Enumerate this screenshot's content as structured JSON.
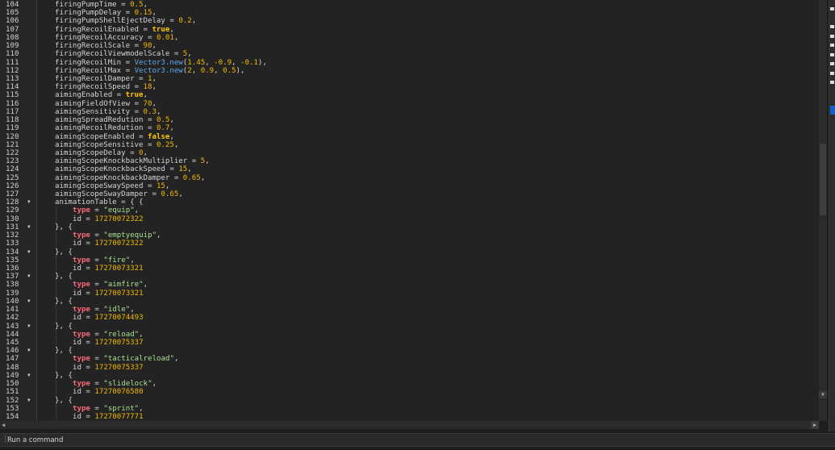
{
  "editor": {
    "lines": [
      {
        "n": "104",
        "i": 0,
        "t": [
          [
            "",
            "firingPumpTime = "
          ],
          [
            "num",
            "0.5"
          ],
          [
            "",
            ","
          ]
        ]
      },
      {
        "n": "105",
        "i": 0,
        "t": [
          [
            "",
            "firingPumpDelay = "
          ],
          [
            "num",
            "0.15"
          ],
          [
            "",
            ","
          ]
        ]
      },
      {
        "n": "106",
        "i": 0,
        "t": [
          [
            "",
            "firingPumpShellEjectDelay = "
          ],
          [
            "num",
            "0.2"
          ],
          [
            "",
            ","
          ]
        ]
      },
      {
        "n": "107",
        "i": 0,
        "t": [
          [
            "",
            "firingRecoilEnabled = "
          ],
          [
            "bool",
            "true"
          ],
          [
            "",
            ","
          ]
        ]
      },
      {
        "n": "108",
        "i": 0,
        "t": [
          [
            "",
            "firingRecoilAccuracy = "
          ],
          [
            "num",
            "0.01"
          ],
          [
            "",
            ","
          ]
        ]
      },
      {
        "n": "109",
        "i": 0,
        "t": [
          [
            "",
            "firingRecoilScale = "
          ],
          [
            "num",
            "90"
          ],
          [
            "",
            ","
          ]
        ]
      },
      {
        "n": "110",
        "i": 0,
        "t": [
          [
            "",
            "firingRecoilViewmodelScale = "
          ],
          [
            "num",
            "5"
          ],
          [
            "",
            ","
          ]
        ]
      },
      {
        "n": "111",
        "i": 0,
        "t": [
          [
            "",
            "firingRecoilMin = "
          ],
          [
            "cls",
            "Vector3.new"
          ],
          [
            "",
            "("
          ],
          [
            "num",
            "1.45"
          ],
          [
            "",
            ", "
          ],
          [
            "num",
            "-0.9"
          ],
          [
            "",
            ", "
          ],
          [
            "num",
            "-0.1"
          ],
          [
            "",
            "),"
          ]
        ]
      },
      {
        "n": "112",
        "i": 0,
        "t": [
          [
            "",
            "firingRecoilMax = "
          ],
          [
            "cls",
            "Vector3.new"
          ],
          [
            "",
            "("
          ],
          [
            "num",
            "2"
          ],
          [
            "",
            ", "
          ],
          [
            "num",
            "0.9"
          ],
          [
            "",
            ", "
          ],
          [
            "num",
            "0.5"
          ],
          [
            "",
            "),"
          ]
        ]
      },
      {
        "n": "113",
        "i": 0,
        "t": [
          [
            "",
            "firingRecoilDamper = "
          ],
          [
            "num",
            "1"
          ],
          [
            "",
            ","
          ]
        ]
      },
      {
        "n": "114",
        "i": 0,
        "t": [
          [
            "",
            "firingRecoilSpeed = "
          ],
          [
            "num",
            "18"
          ],
          [
            "",
            ","
          ]
        ]
      },
      {
        "n": "115",
        "i": 0,
        "t": [
          [
            "",
            "aimingEnabled = "
          ],
          [
            "bool",
            "true"
          ],
          [
            "",
            ","
          ]
        ]
      },
      {
        "n": "116",
        "i": 0,
        "t": [
          [
            "",
            "aimingFieldOfView = "
          ],
          [
            "num",
            "70"
          ],
          [
            "",
            ","
          ]
        ]
      },
      {
        "n": "117",
        "i": 0,
        "t": [
          [
            "",
            "aimingSensitivity = "
          ],
          [
            "num",
            "0.3"
          ],
          [
            "",
            ","
          ]
        ]
      },
      {
        "n": "118",
        "i": 0,
        "t": [
          [
            "",
            "aimingSpreadRedution = "
          ],
          [
            "num",
            "0.5"
          ],
          [
            "",
            ","
          ]
        ]
      },
      {
        "n": "119",
        "i": 0,
        "t": [
          [
            "",
            "aimingRecoilRedution = "
          ],
          [
            "num",
            "0.7"
          ],
          [
            "",
            ","
          ]
        ]
      },
      {
        "n": "120",
        "i": 0,
        "t": [
          [
            "",
            "aimingScopeEnabled = "
          ],
          [
            "bool",
            "false"
          ],
          [
            "",
            ","
          ]
        ]
      },
      {
        "n": "121",
        "i": 0,
        "t": [
          [
            "",
            "aimingScopeSensitive = "
          ],
          [
            "num",
            "0.25"
          ],
          [
            "",
            ","
          ]
        ]
      },
      {
        "n": "122",
        "i": 0,
        "t": [
          [
            "",
            "aimingScopeDelay = "
          ],
          [
            "num",
            "0"
          ],
          [
            "",
            ","
          ]
        ]
      },
      {
        "n": "123",
        "i": 0,
        "t": [
          [
            "",
            "aimingScopeKnockbackMultiplier = "
          ],
          [
            "num",
            "5"
          ],
          [
            "",
            ","
          ]
        ]
      },
      {
        "n": "124",
        "i": 0,
        "t": [
          [
            "",
            "aimingScopeKnockbackSpeed = "
          ],
          [
            "num",
            "15"
          ],
          [
            "",
            ","
          ]
        ]
      },
      {
        "n": "125",
        "i": 0,
        "t": [
          [
            "",
            "aimingScopeKnockbackDamper = "
          ],
          [
            "num",
            "0.65"
          ],
          [
            "",
            ","
          ]
        ]
      },
      {
        "n": "126",
        "i": 0,
        "t": [
          [
            "",
            "aimingScopeSwaySpeed = "
          ],
          [
            "num",
            "15"
          ],
          [
            "",
            ","
          ]
        ]
      },
      {
        "n": "127",
        "i": 0,
        "t": [
          [
            "",
            "aimingScopeSwayDamper = "
          ],
          [
            "num",
            "0.65"
          ],
          [
            "",
            ","
          ]
        ]
      },
      {
        "n": "128",
        "i": 0,
        "f": 1,
        "t": [
          [
            "",
            "animationTable = { {"
          ]
        ]
      },
      {
        "n": "129",
        "i": 1,
        "t": [
          [
            "kw",
            "type"
          ],
          [
            "",
            " = "
          ],
          [
            "str",
            "\"equip\""
          ],
          [
            "",
            ","
          ]
        ]
      },
      {
        "n": "130",
        "i": 1,
        "t": [
          [
            "",
            "id = "
          ],
          [
            "num",
            "17270072322"
          ]
        ]
      },
      {
        "n": "131",
        "i": 0,
        "f": 1,
        "t": [
          [
            "",
            "}, {"
          ]
        ]
      },
      {
        "n": "132",
        "i": 1,
        "t": [
          [
            "kw",
            "type"
          ],
          [
            "",
            " = "
          ],
          [
            "str",
            "\"emptyequip\""
          ],
          [
            "",
            ","
          ]
        ]
      },
      {
        "n": "133",
        "i": 1,
        "t": [
          [
            "",
            "id = "
          ],
          [
            "num",
            "17270072322"
          ]
        ]
      },
      {
        "n": "134",
        "i": 0,
        "f": 1,
        "t": [
          [
            "",
            "}, {"
          ]
        ]
      },
      {
        "n": "135",
        "i": 1,
        "t": [
          [
            "kw",
            "type"
          ],
          [
            "",
            " = "
          ],
          [
            "str",
            "\"fire\""
          ],
          [
            "",
            ","
          ]
        ]
      },
      {
        "n": "136",
        "i": 1,
        "t": [
          [
            "",
            "id = "
          ],
          [
            "num",
            "17270073321"
          ]
        ]
      },
      {
        "n": "137",
        "i": 0,
        "f": 1,
        "t": [
          [
            "",
            "}, {"
          ]
        ]
      },
      {
        "n": "138",
        "i": 1,
        "t": [
          [
            "kw",
            "type"
          ],
          [
            "",
            " = "
          ],
          [
            "str",
            "\"aimfire\""
          ],
          [
            "",
            ","
          ]
        ]
      },
      {
        "n": "139",
        "i": 1,
        "t": [
          [
            "",
            "id = "
          ],
          [
            "num",
            "17270073321"
          ]
        ]
      },
      {
        "n": "140",
        "i": 0,
        "f": 1,
        "t": [
          [
            "",
            "}, {"
          ]
        ]
      },
      {
        "n": "141",
        "i": 1,
        "t": [
          [
            "kw",
            "type"
          ],
          [
            "",
            " = "
          ],
          [
            "str",
            "\"idle\""
          ],
          [
            "",
            ","
          ]
        ]
      },
      {
        "n": "142",
        "i": 1,
        "t": [
          [
            "",
            "id = "
          ],
          [
            "num",
            "17270074493"
          ]
        ]
      },
      {
        "n": "143",
        "i": 0,
        "f": 1,
        "t": [
          [
            "",
            "}, {"
          ]
        ]
      },
      {
        "n": "144",
        "i": 1,
        "t": [
          [
            "kw",
            "type"
          ],
          [
            "",
            " = "
          ],
          [
            "str",
            "\"reload\""
          ],
          [
            "",
            ","
          ]
        ]
      },
      {
        "n": "145",
        "i": 1,
        "t": [
          [
            "",
            "id = "
          ],
          [
            "num",
            "17270075337"
          ]
        ]
      },
      {
        "n": "146",
        "i": 0,
        "f": 1,
        "t": [
          [
            "",
            "}, {"
          ]
        ]
      },
      {
        "n": "147",
        "i": 1,
        "t": [
          [
            "kw",
            "type"
          ],
          [
            "",
            " = "
          ],
          [
            "str",
            "\"tacticalreload\""
          ],
          [
            "",
            ","
          ]
        ]
      },
      {
        "n": "148",
        "i": 1,
        "t": [
          [
            "",
            "id = "
          ],
          [
            "num",
            "17270075337"
          ]
        ]
      },
      {
        "n": "149",
        "i": 0,
        "f": 1,
        "t": [
          [
            "",
            "}, {"
          ]
        ]
      },
      {
        "n": "150",
        "i": 1,
        "t": [
          [
            "kw",
            "type"
          ],
          [
            "",
            " = "
          ],
          [
            "str",
            "\"slidelock\""
          ],
          [
            "",
            ","
          ]
        ]
      },
      {
        "n": "151",
        "i": 1,
        "t": [
          [
            "",
            "id = "
          ],
          [
            "num",
            "17270076580"
          ]
        ]
      },
      {
        "n": "152",
        "i": 0,
        "f": 1,
        "t": [
          [
            "",
            "}, {"
          ]
        ]
      },
      {
        "n": "153",
        "i": 1,
        "t": [
          [
            "kw",
            "type"
          ],
          [
            "",
            " = "
          ],
          [
            "str",
            "\"sprint\""
          ],
          [
            "",
            ","
          ]
        ]
      },
      {
        "n": "154",
        "i": 1,
        "t": [
          [
            "",
            "id = "
          ],
          [
            "num",
            "17270077771"
          ]
        ]
      }
    ]
  },
  "command_bar": {
    "placeholder": "Run a command"
  },
  "icons": {
    "fold": "chevron-down-icon",
    "grip": "grip-vertical-icon"
  }
}
